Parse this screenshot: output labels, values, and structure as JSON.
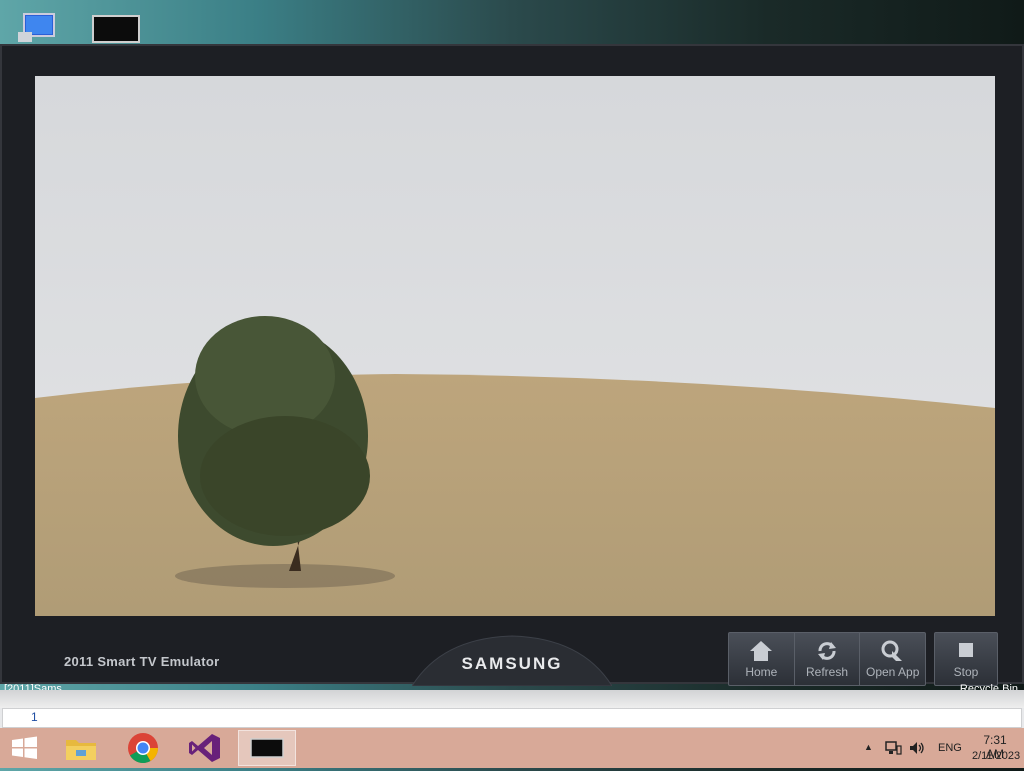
{
  "desktop": {
    "icons": [
      {
        "name": "computer-icon"
      },
      {
        "name": "tv-emulator-icon"
      }
    ],
    "label_left": "[2011]Sams",
    "label_right": "Recycle Bin"
  },
  "emulator": {
    "title": "2011 Smart TV Emulator",
    "brand": "SAMSUNG",
    "buttons": {
      "home": "Home",
      "refresh": "Refresh",
      "open_app": "Open App",
      "stop": "Stop"
    }
  },
  "output": {
    "text": "1"
  },
  "taskbar": {
    "items": [
      "start",
      "file-explorer",
      "chrome",
      "visual-studio",
      "tv-emulator"
    ],
    "tray": {
      "language": "ENG",
      "time": "7:31 AM",
      "date": "2/11/2023"
    }
  }
}
